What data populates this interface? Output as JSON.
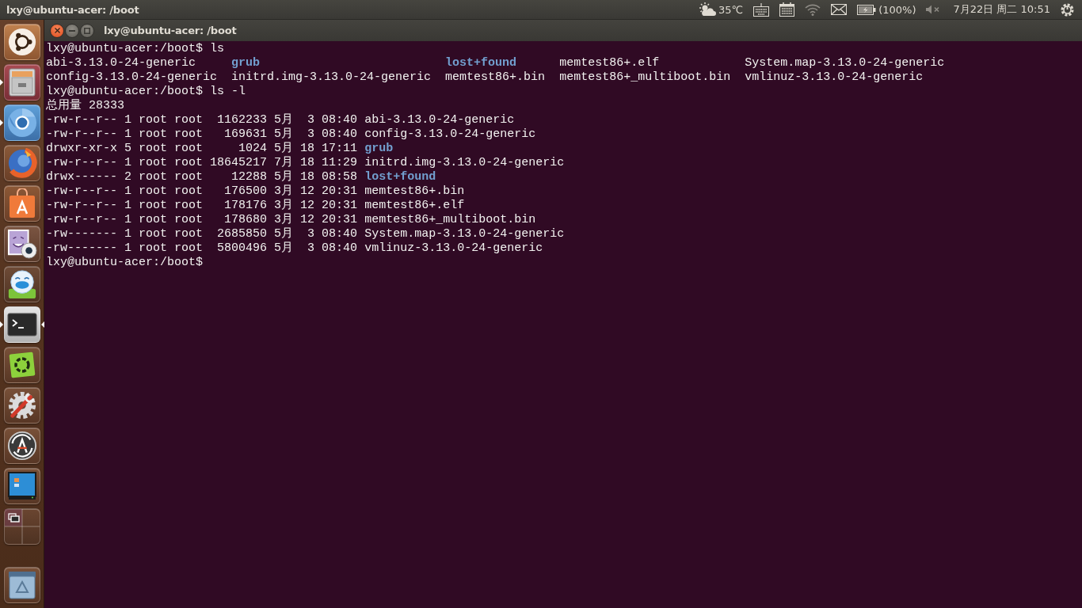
{
  "top_panel": {
    "title": "lxy@ubuntu-acer: /boot",
    "weather": "35℃",
    "battery": "(100%)",
    "volume": {
      "muted": true
    },
    "clock": "7月22日 周二 10:51"
  },
  "launcher": {
    "items": [
      {
        "kind": "dash",
        "running": false,
        "focused": false
      },
      {
        "kind": "files",
        "running": true,
        "focused": false
      },
      {
        "kind": "chromium",
        "running": true,
        "focused": false
      },
      {
        "kind": "firefox",
        "running": false,
        "focused": false
      },
      {
        "kind": "software",
        "running": false,
        "focused": false
      },
      {
        "kind": "webcam",
        "running": false,
        "focused": false
      },
      {
        "kind": "chat",
        "running": false,
        "focused": false
      },
      {
        "kind": "terminal",
        "running": true,
        "focused": true
      },
      {
        "kind": "tweak",
        "running": false,
        "focused": false
      },
      {
        "kind": "settings",
        "running": false,
        "focused": false
      },
      {
        "kind": "updater",
        "running": false,
        "focused": false
      },
      {
        "kind": "monitor",
        "running": false,
        "focused": false
      },
      {
        "kind": "workspaces",
        "running": false,
        "focused": false
      },
      {
        "kind": "trash",
        "running": false,
        "focused": false
      }
    ]
  },
  "window": {
    "title": "lxy@ubuntu-acer: /boot"
  },
  "terminal": {
    "lines": [
      {
        "kind": "prompt",
        "prompt": "lxy@ubuntu-acer:/boot$",
        "command": "ls"
      },
      {
        "kind": "columns",
        "rows": [
          [
            {
              "name": "abi-3.13.0-24-generic",
              "kind": "file"
            },
            {
              "name": "grub",
              "kind": "dir"
            },
            {
              "name": "lost+found",
              "kind": "dir"
            },
            {
              "name": "memtest86+.elf",
              "kind": "file"
            },
            {
              "name": "System.map-3.13.0-24-generic",
              "kind": "file"
            }
          ],
          [
            {
              "name": "config-3.13.0-24-generic",
              "kind": "file"
            },
            {
              "name": "initrd.img-3.13.0-24-generic",
              "kind": "file"
            },
            {
              "name": "memtest86+.bin",
              "kind": "file"
            },
            {
              "name": "memtest86+_multiboot.bin",
              "kind": "file"
            },
            {
              "name": "vmlinuz-3.13.0-24-generic",
              "kind": "file"
            }
          ]
        ]
      },
      {
        "kind": "prompt",
        "prompt": "lxy@ubuntu-acer:/boot$",
        "command": "ls -l"
      },
      {
        "kind": "text",
        "text": "总用量 28333"
      },
      {
        "kind": "long_listing",
        "entries": [
          {
            "mode": "-rw-r--r--",
            "links": "1",
            "owner": "root",
            "group": "root",
            "size": "1162233",
            "month": "5月",
            "day": "3",
            "time": "08:40",
            "name": "abi-3.13.0-24-generic",
            "kind": "file"
          },
          {
            "mode": "-rw-r--r--",
            "links": "1",
            "owner": "root",
            "group": "root",
            "size": "169631",
            "month": "5月",
            "day": "3",
            "time": "08:40",
            "name": "config-3.13.0-24-generic",
            "kind": "file"
          },
          {
            "mode": "drwxr-xr-x",
            "links": "5",
            "owner": "root",
            "group": "root",
            "size": "1024",
            "month": "5月",
            "day": "18",
            "time": "17:11",
            "name": "grub",
            "kind": "dir"
          },
          {
            "mode": "-rw-r--r--",
            "links": "1",
            "owner": "root",
            "group": "root",
            "size": "18645217",
            "month": "7月",
            "day": "18",
            "time": "11:29",
            "name": "initrd.img-3.13.0-24-generic",
            "kind": "file"
          },
          {
            "mode": "drwx------",
            "links": "2",
            "owner": "root",
            "group": "root",
            "size": "12288",
            "month": "5月",
            "day": "18",
            "time": "08:58",
            "name": "lost+found",
            "kind": "dir"
          },
          {
            "mode": "-rw-r--r--",
            "links": "1",
            "owner": "root",
            "group": "root",
            "size": "176500",
            "month": "3月",
            "day": "12",
            "time": "20:31",
            "name": "memtest86+.bin",
            "kind": "file"
          },
          {
            "mode": "-rw-r--r--",
            "links": "1",
            "owner": "root",
            "group": "root",
            "size": "178176",
            "month": "3月",
            "day": "12",
            "time": "20:31",
            "name": "memtest86+.elf",
            "kind": "file"
          },
          {
            "mode": "-rw-r--r--",
            "links": "1",
            "owner": "root",
            "group": "root",
            "size": "178680",
            "month": "3月",
            "day": "12",
            "time": "20:31",
            "name": "memtest86+_multiboot.bin",
            "kind": "file"
          },
          {
            "mode": "-rw-------",
            "links": "1",
            "owner": "root",
            "group": "root",
            "size": "2685850",
            "month": "5月",
            "day": "3",
            "time": "08:40",
            "name": "System.map-3.13.0-24-generic",
            "kind": "file"
          },
          {
            "mode": "-rw-------",
            "links": "1",
            "owner": "root",
            "group": "root",
            "size": "5800496",
            "month": "5月",
            "day": "3",
            "time": "08:40",
            "name": "vmlinuz-3.13.0-24-generic",
            "kind": "file"
          }
        ]
      },
      {
        "kind": "prompt",
        "prompt": "lxy@ubuntu-acer:/boot$"
      }
    ]
  }
}
